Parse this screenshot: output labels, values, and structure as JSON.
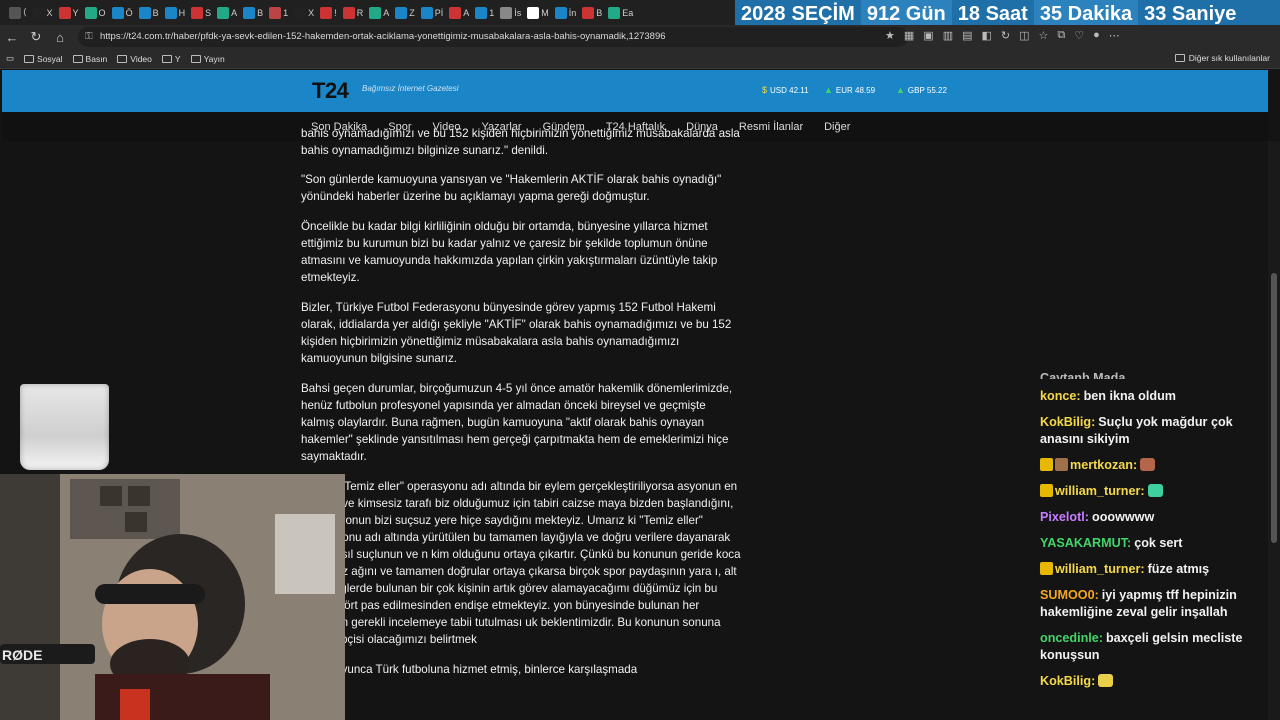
{
  "browser": {
    "tabs": [
      "⟨",
      "X",
      "Y",
      "O",
      "Ö",
      "B",
      "H",
      "S",
      "A",
      "B",
      "1",
      "X",
      "!",
      "R",
      "A",
      "Z",
      "Pİ",
      "A",
      "1",
      "İs",
      "M",
      "İn",
      "B",
      "Ea"
    ],
    "url": "https://t24.com.tr/haber/pfdk-ya-sevk-edilen-152-hakemden-ortak-aciklama-yonettigimiz-musabakalara-asla-bahis-oynamadik,1273896",
    "bookmarks": [
      "Sosyal",
      "Basın",
      "Video",
      "Y",
      "Yayın"
    ],
    "other_bookmarks": "Diğer sık kullanılanlar"
  },
  "countdown": {
    "year": "2028",
    "label": "SEÇİM",
    "days": "912 Gün",
    "hours": "18 Saat",
    "minutes": "35 Dakika",
    "seconds": "33 Saniye"
  },
  "site": {
    "logo": "T24",
    "tagline": "Bağımsız İnternet Gazetesi",
    "fx": [
      {
        "label": "USD 42.11"
      },
      {
        "label": "EUR 48.59"
      },
      {
        "label": "GBP 55.22"
      }
    ],
    "nav": [
      "Son Dakika",
      "Spor",
      "Video",
      "Yazarlar",
      "Gündem",
      "T24 Haftalık",
      "Dünya",
      "Resmi İlanlar",
      "Diğer"
    ]
  },
  "article": {
    "paragraphs": [
      "bahis oynamadığımızı ve bu 152 kişiden hiçbirimizin yönettiğimiz müsabakalarda asla bahis oynamadığımızı bilginize sunarız.\" denildi.",
      "\"Son günlerde kamuoyuna yansıyan ve \"Hakemlerin AKTİF olarak bahis oynadığı\" yönündeki haberler üzerine bu açıklamayı yapma gereği doğmuştur.",
      "Öncelikle bu kadar bilgi kirliliğinin olduğu bir ortamda, bünyesine yıllarca hizmet ettiğimiz bu kurumun bizi bu kadar yalnız ve çaresiz bir şekilde toplumun önüne atmasını ve kamuoyunda hakkımızda yapılan çirkin yakıştırmaları üzüntüyle takip etmekteyiz.",
      "Bizler, Türkiye Futbol Federasyonu bünyesinde görev yapmış 152 Futbol Hakemi olarak, iddialarda yer aldığı şekliyle \"AKTİF\" olarak bahis oynamadığımızı ve bu 152 kişiden hiçbirimizin yönettiğimiz müsabakalara asla bahis oynamadığımızı kamuoyunun bilgisine sunarız.",
      "Bahsi geçen durumlar, birçoğumuzun 4-5 yıl önce amatör hakemlik dönemlerimizde, henüz futbolun profesyonel yapısında yer almadan önceki bireysel ve geçmişte kalmış olaylardır. Buna rağmen, bugün kamuoyuna \"aktif olarak bahis oynayan hakemler\" şeklinde yansıtılması hem gerçeği çarpıtmakta hem de emeklerimizi hiçe saymaktadır.",
      "Boluna \"Temiz eller\" operasyonu adı altında bir eylem gerçekleştiriliyorsa asyonun en masum ve kimsesiz tarafı biz olduğumuz için tabiri caizse maya bizden başlandığını, federasyonun bizi suçsuz yere hiçe saydığını mekteyiz. Umarız ki \"Temiz eller\" operasyonu adı altında yürütülen bu tamamen layığıyla ve doğru verilere dayanarak ilerler, asıl suçlunun ve n kim olduğunu ortaya çıkartır. Çünkü bu konunun geride koca bir enkaz ağını ve tamamen doğrular ortaya çıkarsa birçok spor paydaşının yara ı, alt ve üst liglerde bulunan bir çok kişinin artık görev alamayacağımı düğümüz için bu eylemin ört pas edilmesinden endişe etmekteyiz. yon bünyesinde bulunan her paydaşın gerekli incelemeye tabii tutulması uk beklentimizdir. Bu konunun sonuna dek takipçisi olacağımızı belirtmek",
      "yıllar boyunca Türk futboluna hizmet etmiş, binlerce karşılaşmada"
    ]
  },
  "chat": [
    {
      "user": "",
      "text": "",
      "partial": "Çaytanb Mada"
    },
    {
      "user": "konce:",
      "text": "ben ikna oldum",
      "color": "#f5d94a"
    },
    {
      "user": "KokBilig:",
      "text": "Suçlu yok mağdur çok anasını sikiyim",
      "color": "#f5d94a"
    },
    {
      "user": "mertkozan:",
      "text": "",
      "color": "#f5d94a",
      "badges": 2,
      "emote": true
    },
    {
      "user": "william_turner:",
      "text": "",
      "color": "#f5d94a",
      "badges": 1,
      "emote": true
    },
    {
      "user": "Pixelotl:",
      "text": "ooowwww",
      "color": "#c77dff"
    },
    {
      "user": "YASAKARMUT:",
      "text": "çok sert",
      "color": "#44d36a"
    },
    {
      "user": "william_turner:",
      "text": "füze atmış",
      "color": "#f5d94a",
      "badges": 1
    },
    {
      "user": "SUMOO0:",
      "text": "iyi yapmış tff hepinizin hakemliğine zeval gelir inşallah",
      "color": "#f5a623"
    },
    {
      "user": "oncedinle:",
      "text": "baxçeli gelsin mecliste konuşsun",
      "color": "#44d36a"
    },
    {
      "user": "KokBilig:",
      "text": "",
      "color": "#f5d94a",
      "emote": true
    }
  ]
}
